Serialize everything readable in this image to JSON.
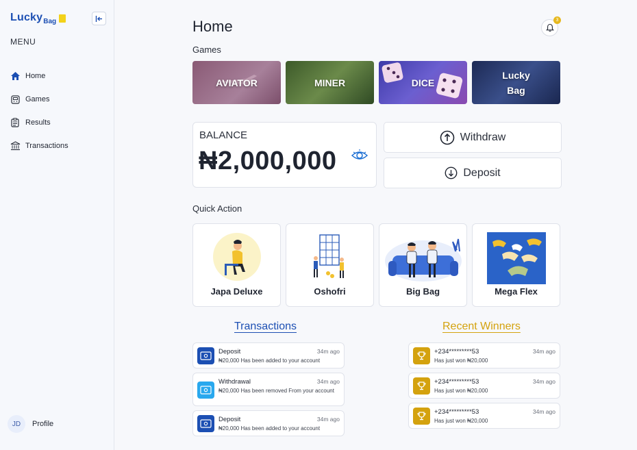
{
  "sidebar": {
    "logo_main": "Lucky",
    "logo_sub": "Bag",
    "menu_title": "MENU",
    "items": [
      {
        "label": "Home",
        "icon": "home-icon"
      },
      {
        "label": "Games",
        "icon": "games-icon"
      },
      {
        "label": "Results",
        "icon": "results-icon"
      },
      {
        "label": "Transactions",
        "icon": "bank-icon"
      }
    ],
    "profile": {
      "initials": "JD",
      "label": "Profile"
    }
  },
  "header": {
    "title": "Home",
    "notification_count": "3"
  },
  "games": {
    "label": "Games",
    "items": [
      "AVIATOR",
      "MINER",
      "DICE",
      "Lucky Bag"
    ]
  },
  "balance": {
    "label": "BALANCE",
    "amount": "₦2,000,000"
  },
  "actions": {
    "withdraw": "Withdraw",
    "deposit": "Deposit"
  },
  "quick_action": {
    "label": "Quick Action",
    "items": [
      "Japa Deluxe",
      "Oshofri",
      "Big Bag",
      "Mega Flex"
    ]
  },
  "transactions": {
    "title": "Transactions",
    "rows": [
      {
        "title": "Deposit",
        "desc": "₦20,000 Has been added to your account",
        "time": "34m ago"
      },
      {
        "title": "Withdrawal",
        "desc": "₦20,000 Has been removed From your account",
        "time": "34m ago"
      },
      {
        "title": "Deposit",
        "desc": "₦20,000 Has been added to your account",
        "time": "34m ago"
      }
    ]
  },
  "winners": {
    "title": "Recent Winners",
    "rows": [
      {
        "phone": "+234*********53",
        "desc": "Has just won ₦20,000",
        "time": "34m ago"
      },
      {
        "phone": "+234*********53",
        "desc": "Has just won ₦20,000",
        "time": "34m ago"
      },
      {
        "phone": "+234*********53",
        "desc": "Has just won ₦20,000",
        "time": "34m ago"
      }
    ]
  },
  "colors": {
    "brand_blue": "#1c4fb3",
    "gold": "#d4a20e"
  }
}
